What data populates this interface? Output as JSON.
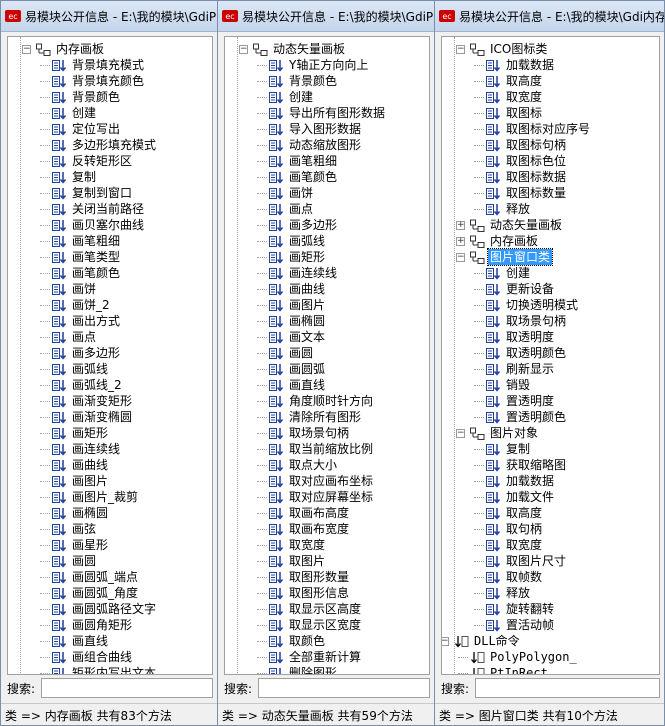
{
  "windows": [
    {
      "id": "w1",
      "title": "易模块公开信息 - E:\\我的模块\\GdiP",
      "search_label": "搜索:",
      "status": "类 => 内存画板   共有83个方法",
      "rows": [
        {
          "level": 0,
          "kind": "class",
          "label": "内存画板",
          "expanded": true
        },
        {
          "level": 1,
          "kind": "method",
          "label": "背景填充模式"
        },
        {
          "level": 1,
          "kind": "method",
          "label": "背景填充颜色"
        },
        {
          "level": 1,
          "kind": "method",
          "label": "背景颜色"
        },
        {
          "level": 1,
          "kind": "method",
          "label": "创建"
        },
        {
          "level": 1,
          "kind": "method",
          "label": "定位写出"
        },
        {
          "level": 1,
          "kind": "method",
          "label": "多边形填充模式"
        },
        {
          "level": 1,
          "kind": "method",
          "label": "反转矩形区"
        },
        {
          "level": 1,
          "kind": "method",
          "label": "复制"
        },
        {
          "level": 1,
          "kind": "method",
          "label": "复制到窗口"
        },
        {
          "level": 1,
          "kind": "method",
          "label": "关闭当前路径"
        },
        {
          "level": 1,
          "kind": "method",
          "label": "画贝塞尔曲线"
        },
        {
          "level": 1,
          "kind": "method",
          "label": "画笔粗细"
        },
        {
          "level": 1,
          "kind": "method",
          "label": "画笔类型"
        },
        {
          "level": 1,
          "kind": "method",
          "label": "画笔颜色"
        },
        {
          "level": 1,
          "kind": "method",
          "label": "画饼"
        },
        {
          "level": 1,
          "kind": "method",
          "label": "画饼_2"
        },
        {
          "level": 1,
          "kind": "method",
          "label": "画出方式"
        },
        {
          "level": 1,
          "kind": "method",
          "label": "画点"
        },
        {
          "level": 1,
          "kind": "method",
          "label": "画多边形"
        },
        {
          "level": 1,
          "kind": "method",
          "label": "画弧线"
        },
        {
          "level": 1,
          "kind": "method",
          "label": "画弧线_2"
        },
        {
          "level": 1,
          "kind": "method",
          "label": "画渐变矩形"
        },
        {
          "level": 1,
          "kind": "method",
          "label": "画渐变椭圆"
        },
        {
          "level": 1,
          "kind": "method",
          "label": "画矩形"
        },
        {
          "level": 1,
          "kind": "method",
          "label": "画连续线"
        },
        {
          "level": 1,
          "kind": "method",
          "label": "画曲线"
        },
        {
          "level": 1,
          "kind": "method",
          "label": "画图片"
        },
        {
          "level": 1,
          "kind": "method",
          "label": "画图片_裁剪"
        },
        {
          "level": 1,
          "kind": "method",
          "label": "画椭圆"
        },
        {
          "level": 1,
          "kind": "method",
          "label": "画弦"
        },
        {
          "level": 1,
          "kind": "method",
          "label": "画星形"
        },
        {
          "level": 1,
          "kind": "method",
          "label": "画圆"
        },
        {
          "level": 1,
          "kind": "method",
          "label": "画圆弧_端点"
        },
        {
          "level": 1,
          "kind": "method",
          "label": "画圆弧_角度"
        },
        {
          "level": 1,
          "kind": "method",
          "label": "画圆弧路径文字"
        },
        {
          "level": 1,
          "kind": "method",
          "label": "画圆角矩形"
        },
        {
          "level": 1,
          "kind": "method",
          "label": "画直线"
        },
        {
          "level": 1,
          "kind": "method",
          "label": "画组合曲线"
        },
        {
          "level": 1,
          "kind": "method",
          "label": "矩形内写出文本"
        }
      ]
    },
    {
      "id": "w2",
      "title": "易模块公开信息 - E:\\我的模块\\GdiP",
      "search_label": "搜索:",
      "status": "类 => 动态矢量画板   共有59个方法",
      "rows": [
        {
          "level": 0,
          "kind": "class",
          "label": "动态矢量画板",
          "expanded": true
        },
        {
          "level": 1,
          "kind": "method",
          "label": "Y轴正方向向上"
        },
        {
          "level": 1,
          "kind": "method",
          "label": "背景颜色"
        },
        {
          "level": 1,
          "kind": "method",
          "label": "创建"
        },
        {
          "level": 1,
          "kind": "method",
          "label": "导出所有图形数据"
        },
        {
          "level": 1,
          "kind": "method",
          "label": "导入图形数据"
        },
        {
          "level": 1,
          "kind": "method",
          "label": "动态缩放图形"
        },
        {
          "level": 1,
          "kind": "method",
          "label": "画笔粗细"
        },
        {
          "level": 1,
          "kind": "method",
          "label": "画笔颜色"
        },
        {
          "level": 1,
          "kind": "method",
          "label": "画饼"
        },
        {
          "level": 1,
          "kind": "method",
          "label": "画点"
        },
        {
          "level": 1,
          "kind": "method",
          "label": "画多边形"
        },
        {
          "level": 1,
          "kind": "method",
          "label": "画弧线"
        },
        {
          "level": 1,
          "kind": "method",
          "label": "画矩形"
        },
        {
          "level": 1,
          "kind": "method",
          "label": "画连续线"
        },
        {
          "level": 1,
          "kind": "method",
          "label": "画曲线"
        },
        {
          "level": 1,
          "kind": "method",
          "label": "画图片"
        },
        {
          "level": 1,
          "kind": "method",
          "label": "画椭圆"
        },
        {
          "level": 1,
          "kind": "method",
          "label": "画文本"
        },
        {
          "level": 1,
          "kind": "method",
          "label": "画圆"
        },
        {
          "level": 1,
          "kind": "method",
          "label": "画圆弧"
        },
        {
          "level": 1,
          "kind": "method",
          "label": "画直线"
        },
        {
          "level": 1,
          "kind": "method",
          "label": "角度顺时针方向"
        },
        {
          "level": 1,
          "kind": "method",
          "label": "清除所有图形"
        },
        {
          "level": 1,
          "kind": "method",
          "label": "取场景句柄"
        },
        {
          "level": 1,
          "kind": "method",
          "label": "取当前缩放比例"
        },
        {
          "level": 1,
          "kind": "method",
          "label": "取点大小"
        },
        {
          "level": 1,
          "kind": "method",
          "label": "取对应画布坐标"
        },
        {
          "level": 1,
          "kind": "method",
          "label": "取对应屏幕坐标"
        },
        {
          "level": 1,
          "kind": "method",
          "label": "取画布高度"
        },
        {
          "level": 1,
          "kind": "method",
          "label": "取画布宽度"
        },
        {
          "level": 1,
          "kind": "method",
          "label": "取宽度"
        },
        {
          "level": 1,
          "kind": "method",
          "label": "取图片"
        },
        {
          "level": 1,
          "kind": "method",
          "label": "取图形数量"
        },
        {
          "level": 1,
          "kind": "method",
          "label": "取图形信息"
        },
        {
          "level": 1,
          "kind": "method",
          "label": "取显示区高度"
        },
        {
          "level": 1,
          "kind": "method",
          "label": "取显示区宽度"
        },
        {
          "level": 1,
          "kind": "method",
          "label": "取颜色"
        },
        {
          "level": 1,
          "kind": "method",
          "label": "全部重新计算"
        },
        {
          "level": 1,
          "kind": "method",
          "label": "删除图形"
        }
      ]
    },
    {
      "id": "w3",
      "title": "易模块公开信息 - E:\\我的模块\\Gdi内存",
      "search_label": "搜索:",
      "status": "类 => 图片窗口类   共有10个方法",
      "rows": [
        {
          "level": 0,
          "kind": "class",
          "label": "ICO图标类",
          "expanded": true
        },
        {
          "level": 1,
          "kind": "method",
          "label": "加载数据"
        },
        {
          "level": 1,
          "kind": "method",
          "label": "取高度"
        },
        {
          "level": 1,
          "kind": "method",
          "label": "取宽度"
        },
        {
          "level": 1,
          "kind": "method",
          "label": "取图标"
        },
        {
          "level": 1,
          "kind": "method",
          "label": "取图标对应序号"
        },
        {
          "level": 1,
          "kind": "method",
          "label": "取图标句柄"
        },
        {
          "level": 1,
          "kind": "method",
          "label": "取图标色位"
        },
        {
          "level": 1,
          "kind": "method",
          "label": "取图标数据"
        },
        {
          "level": 1,
          "kind": "method",
          "label": "取图标数量"
        },
        {
          "level": 1,
          "kind": "method",
          "label": "释放"
        },
        {
          "level": 0,
          "kind": "class",
          "label": "动态矢量画板",
          "expanded": false
        },
        {
          "level": 0,
          "kind": "class",
          "label": "内存画板",
          "expanded": false
        },
        {
          "level": 0,
          "kind": "class",
          "label": "图片窗口类",
          "expanded": true,
          "selected": true
        },
        {
          "level": 1,
          "kind": "method",
          "label": "创建"
        },
        {
          "level": 1,
          "kind": "method",
          "label": "更新设备"
        },
        {
          "level": 1,
          "kind": "method",
          "label": "切换透明模式"
        },
        {
          "level": 1,
          "kind": "method",
          "label": "取场景句柄"
        },
        {
          "level": 1,
          "kind": "method",
          "label": "取透明度"
        },
        {
          "level": 1,
          "kind": "method",
          "label": "取透明颜色"
        },
        {
          "level": 1,
          "kind": "method",
          "label": "刷新显示"
        },
        {
          "level": 1,
          "kind": "method",
          "label": "销毁"
        },
        {
          "level": 1,
          "kind": "method",
          "label": "置透明度"
        },
        {
          "level": 1,
          "kind": "method",
          "label": "置透明颜色"
        },
        {
          "level": 0,
          "kind": "class",
          "label": "图片对象",
          "expanded": true
        },
        {
          "level": 1,
          "kind": "method",
          "label": "复制"
        },
        {
          "level": 1,
          "kind": "method",
          "label": "获取缩略图"
        },
        {
          "level": 1,
          "kind": "method",
          "label": "加载数据"
        },
        {
          "level": 1,
          "kind": "method",
          "label": "加载文件"
        },
        {
          "level": 1,
          "kind": "method",
          "label": "取高度"
        },
        {
          "level": 1,
          "kind": "method",
          "label": "取句柄"
        },
        {
          "level": 1,
          "kind": "method",
          "label": "取宽度"
        },
        {
          "level": 1,
          "kind": "method",
          "label": "取图片尺寸"
        },
        {
          "level": 1,
          "kind": "method",
          "label": "取帧数"
        },
        {
          "level": 1,
          "kind": "method",
          "label": "释放"
        },
        {
          "level": 1,
          "kind": "method",
          "label": "旋转翻转"
        },
        {
          "level": 1,
          "kind": "method",
          "label": "置活动帧"
        },
        {
          "level": -1,
          "kind": "dll",
          "label": "DLL命令",
          "expanded": true
        },
        {
          "level": 0,
          "kind": "dllfunc",
          "label": "PolyPolygon_"
        },
        {
          "level": 0,
          "kind": "dllfunc",
          "label": "PtInRect"
        }
      ]
    }
  ],
  "colors": {
    "selection": "#3399ff",
    "icon_blue": "#1f3f9f",
    "icon_red": "#cc0000"
  }
}
